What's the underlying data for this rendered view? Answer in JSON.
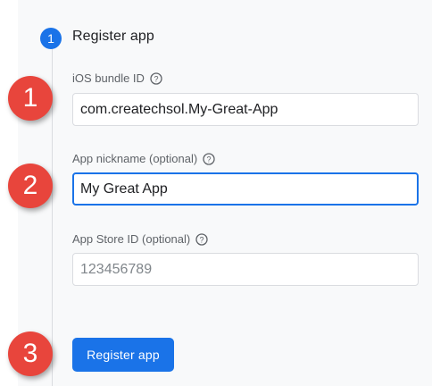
{
  "step": {
    "number": "1",
    "title": "Register app"
  },
  "fields": {
    "bundle_id": {
      "label": "iOS bundle ID",
      "value": "com.createchsol.My-Great-App"
    },
    "nickname": {
      "label": "App nickname (optional)",
      "value": "My Great App"
    },
    "app_store_id": {
      "label": "App Store ID (optional)",
      "placeholder": "123456789"
    }
  },
  "register_button": {
    "label": "Register app"
  },
  "callouts": [
    "1",
    "2",
    "3"
  ],
  "colors": {
    "accent": "#1a73e8",
    "callout": "#e8453c",
    "panel": "#f8f9fa"
  },
  "icons": {
    "help": "help-circle-icon"
  }
}
